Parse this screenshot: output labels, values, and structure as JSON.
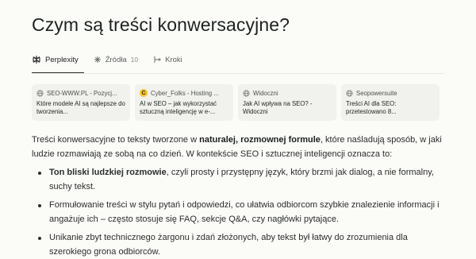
{
  "title": "Czym są treści konwersacyjne?",
  "tabs": [
    {
      "label": "Perplexity",
      "icon": "perplexity-icon",
      "active": true
    },
    {
      "label": "Źródła",
      "count": "10",
      "icon": "sources-icon",
      "active": false
    },
    {
      "label": "Kroki",
      "icon": "steps-icon",
      "active": false
    }
  ],
  "sources": [
    {
      "site": "SEO-WWW.PL - Pozycj...",
      "title": "Które modele AI są najlepsze do tworzenia...",
      "icon": "globe-icon"
    },
    {
      "site": "Cyber_Folks - Hosting ...",
      "title": "AI w SEO – jak wykorzystać sztuczną inteligencję w e-...",
      "icon": "cyberfolks-logo",
      "fav_letter": "C"
    },
    {
      "site": "Widoczni",
      "title": "Jak AI wpływa na SEO? - Widoczni",
      "icon": "globe-icon"
    },
    {
      "site": "Seopowersuite",
      "title": "Treści AI dla SEO: przetestowano 8...",
      "icon": "globe-icon"
    }
  ],
  "answer": {
    "intro_1": "Treści konwersacyjne to teksty tworzone w ",
    "intro_bold": "naturalej, rozmownej formule",
    "intro_2": ", które naśladują sposób, w jaki ludzie rozmawiają ze sobą na co dzień. W kontekście SEO i sztucznej inteligencji oznacza to:",
    "bullets": [
      {
        "bold": "Ton bliski ludzkiej rozmowie",
        "text": ", czyli prosty i przystępny język, który brzmi jak dialog, a nie formalny, suchy tekst."
      },
      {
        "bold": "",
        "text": "Formułowanie treści w stylu pytań i odpowiedzi, co ułatwia odbiorcom szybkie znalezienie informacji i angażuje ich – często stosuje się FAQ, sekcje Q&A, czy nagłówki pytające."
      },
      {
        "bold": "",
        "text": "Unikanie zbyt technicznego żargonu i zdań złożonych, aby tekst był łatwy do zrozumienia dla szerokiego grona odbiorców."
      }
    ]
  },
  "colors": {
    "background": "#fbfbf8",
    "card": "#f1f1ed",
    "text": "#1f2421",
    "favicon_yellow": "#f4c22b"
  }
}
